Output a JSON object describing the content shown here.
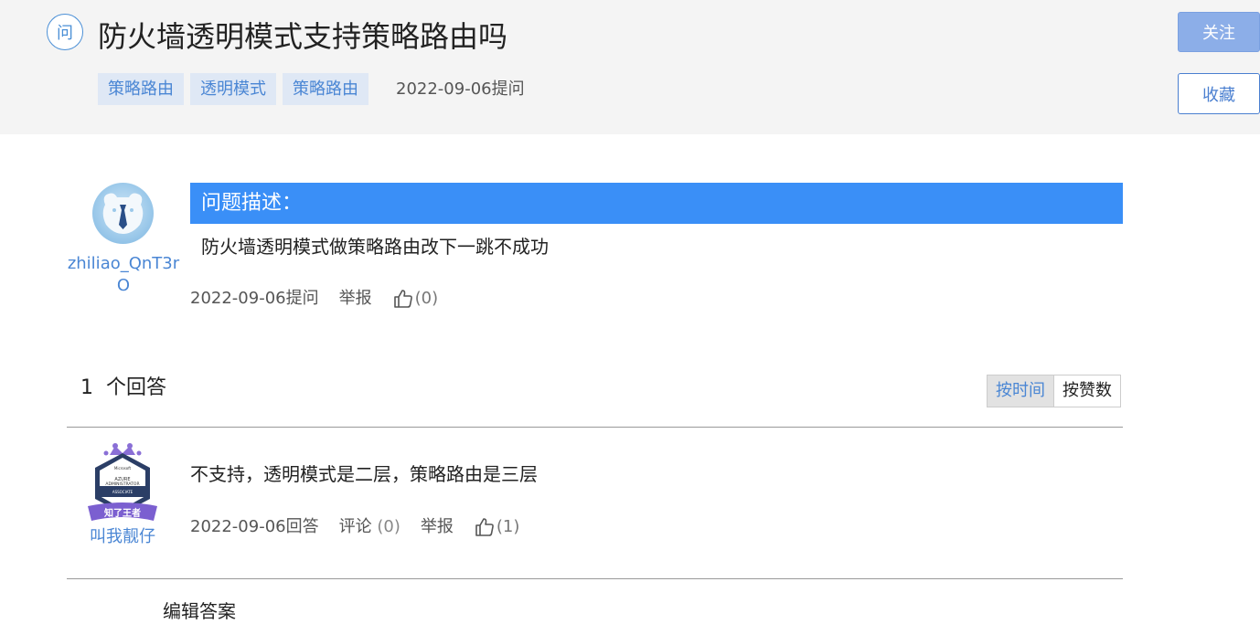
{
  "question": {
    "icon_label": "问",
    "title": "防火墙透明模式支持策略路由吗",
    "tags": [
      "策略路由",
      "透明模式",
      "策略路由"
    ],
    "asked_date": "2022-09-06提问",
    "follow_label": "关注",
    "favorite_label": "收藏"
  },
  "description": {
    "username": "zhiliao_QnT3rO",
    "heading": "问题描述：",
    "text": "防火墙透明模式做策略路由改下一跳不成功",
    "date": "2022-09-06提问",
    "report_label": "举报",
    "like_count": "(0)"
  },
  "answers_header": {
    "count": "1",
    "count_label": "个回答",
    "sort_by_time": "按时间",
    "sort_by_likes": "按赞数"
  },
  "answers": [
    {
      "username": "叫我靓仔",
      "badge_text": "知了王者",
      "text": "不支持，透明模式是二层，策略路由是三层",
      "date": "2022-09-06回答",
      "comment_label": "评论",
      "comment_count": "(0)",
      "report_label": "举报",
      "like_count": "(1)"
    }
  ],
  "edit_answer_label": "编辑答案",
  "colors": {
    "accent_blue": "#3a8ff7",
    "link_blue": "#4a86d4",
    "header_bg": "#f4f4f4"
  }
}
